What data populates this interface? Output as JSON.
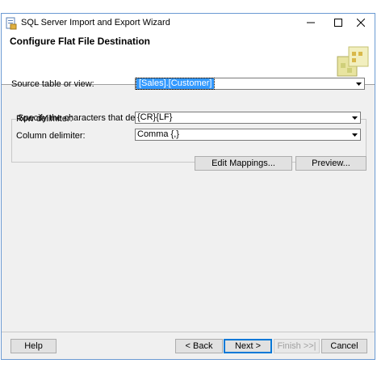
{
  "window": {
    "title": "SQL Server Import and Export Wizard"
  },
  "header": {
    "title": "Configure Flat File Destination"
  },
  "source": {
    "label": "Source table or view:",
    "value": "[Sales].[Customer]"
  },
  "delimiters": {
    "group_label": "Specify the characters that delimit the destination file:",
    "row_label": "Row delimiter:",
    "row_value": "{CR}{LF}",
    "column_label": "Column delimiter:",
    "column_value": "Comma {,}"
  },
  "actions": {
    "edit_mappings": "Edit Mappings...",
    "preview": "Preview..."
  },
  "footer": {
    "help": "Help",
    "back": "< Back",
    "next": "Next >",
    "finish": "Finish >>|",
    "cancel": "Cancel"
  },
  "icons": {
    "app": "wizard-app-icon",
    "minimize": "minimize-icon",
    "maximize": "maximize-icon",
    "close": "close-icon",
    "dropdown": "chevron-down-icon",
    "header_graphic": "import-export-graphic"
  }
}
